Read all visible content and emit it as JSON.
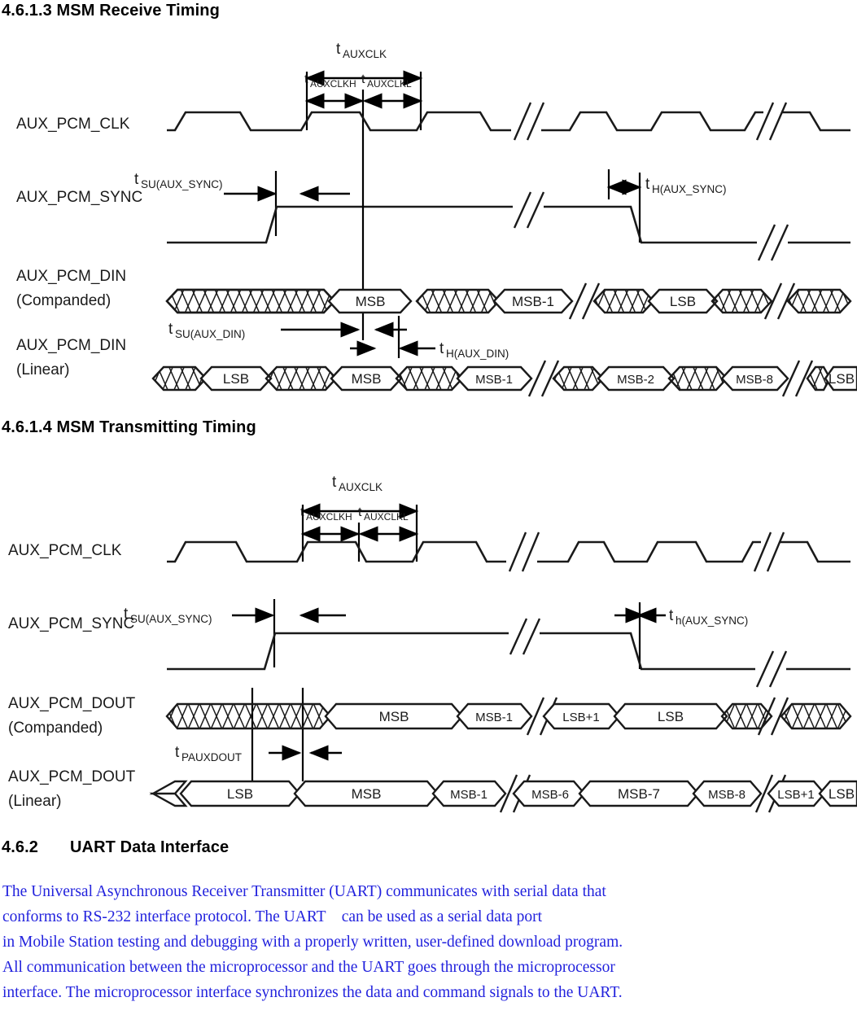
{
  "sections": {
    "receive": {
      "number": "4.6.1.3",
      "title": "MSM Receive Timing",
      "heading": "4.6.1.3 MSM Receive Timing",
      "figure_id": "096-008"
    },
    "transmit": {
      "number": "4.6.1.4",
      "title": "MSM Transmitting Timing",
      "heading": "4.6.1.4 MSM Transmitting Timing"
    },
    "uart": {
      "number": "4.6.2",
      "title": "UART Data Interface"
    }
  },
  "figure_receive": {
    "signals": [
      {
        "name": "AUX_PCM_CLK",
        "sub": ""
      },
      {
        "name": "AUX_PCM_SYNC",
        "sub": ""
      },
      {
        "name": "AUX_PCM_DIN",
        "sub": "(Companded)"
      },
      {
        "name": "AUX_PCM_DIN",
        "sub": "(Linear)"
      }
    ],
    "clock_timings": [
      {
        "base": "t",
        "sub": "AUXCLK"
      },
      {
        "base": "t",
        "sub": "AUXCLKH"
      },
      {
        "base": "t",
        "sub": "AUXCLKL"
      }
    ],
    "annotations": [
      {
        "base": "t",
        "sub": "SU(AUX_SYNC)"
      },
      {
        "base": "t",
        "sub": "H(AUX_SYNC)"
      },
      {
        "base": "t",
        "sub": "SU(AUX_DIN)"
      },
      {
        "base": "t",
        "sub": "H(AUX_DIN)"
      }
    ],
    "din_companded_cells": [
      {
        "type": "hatch",
        "label": ""
      },
      {
        "type": "data",
        "label": "MSB"
      },
      {
        "type": "hatch",
        "label": ""
      },
      {
        "type": "data",
        "label": "MSB-1"
      },
      {
        "type": "break",
        "label": ""
      },
      {
        "type": "hatch",
        "label": ""
      },
      {
        "type": "data",
        "label": "LSB"
      },
      {
        "type": "hatch",
        "label": ""
      },
      {
        "type": "break",
        "label": ""
      },
      {
        "type": "hatch",
        "label": ""
      }
    ],
    "din_linear_cells": [
      {
        "type": "hatch",
        "label": ""
      },
      {
        "type": "data",
        "label": "LSB"
      },
      {
        "type": "hatch",
        "label": ""
      },
      {
        "type": "data",
        "label": "MSB"
      },
      {
        "type": "hatch",
        "label": ""
      },
      {
        "type": "data",
        "label": "MSB-1"
      },
      {
        "type": "break",
        "label": ""
      },
      {
        "type": "hatch",
        "label": ""
      },
      {
        "type": "data",
        "label": "MSB-2"
      },
      {
        "type": "hatch",
        "label": ""
      },
      {
        "type": "data",
        "label": "MSB-8"
      },
      {
        "type": "break",
        "label": ""
      },
      {
        "type": "hatch",
        "label": ""
      },
      {
        "type": "data",
        "label": "LSB"
      }
    ],
    "figure_id": "096-008"
  },
  "figure_transmit": {
    "signals": [
      {
        "name": "AUX_PCM_CLK",
        "sub": ""
      },
      {
        "name": "AUX_PCM_SYNC",
        "sub": ""
      },
      {
        "name": "AUX_PCM_DOUT",
        "sub": "(Companded)"
      },
      {
        "name": "AUX_PCM_DOUT",
        "sub": "(Linear)"
      }
    ],
    "clock_timings": [
      {
        "base": "t",
        "sub": "AUXCLK"
      },
      {
        "base": "t",
        "sub": "AUXCLKH"
      },
      {
        "base": "t",
        "sub": "AUXCLKL"
      }
    ],
    "annotations": [
      {
        "base": "t",
        "sub": "SU(AUX_SYNC)"
      },
      {
        "base": "t",
        "sub": "h(AUX_SYNC)"
      },
      {
        "base": "t",
        "sub": "PAUXDOUT"
      }
    ],
    "dout_companded_cells": [
      {
        "type": "hatch",
        "label": ""
      },
      {
        "type": "data",
        "label": "MSB"
      },
      {
        "type": "data",
        "label": "MSB-1"
      },
      {
        "type": "break",
        "label": ""
      },
      {
        "type": "data",
        "label": "LSB+1"
      },
      {
        "type": "data",
        "label": "LSB"
      },
      {
        "type": "hatch",
        "label": ""
      },
      {
        "type": "break",
        "label": ""
      },
      {
        "type": "hatch",
        "label": ""
      }
    ],
    "dout_linear_cells": [
      {
        "type": "data",
        "label": "LSB"
      },
      {
        "type": "data",
        "label": "MSB"
      },
      {
        "type": "data",
        "label": "MSB-1"
      },
      {
        "type": "break",
        "label": ""
      },
      {
        "type": "data",
        "label": "MSB-6"
      },
      {
        "type": "data",
        "label": "MSB-7"
      },
      {
        "type": "data",
        "label": "MSB-8"
      },
      {
        "type": "break",
        "label": ""
      },
      {
        "type": "data",
        "label": "LSB+1"
      },
      {
        "type": "data",
        "label": "LSB"
      }
    ]
  },
  "uart_body": {
    "line1": "The Universal Asynchronous Receiver Transmitter (UART) communicates with serial data that",
    "line2": "conforms to RS-232 interface protocol. The UART    can be used as a serial data port",
    "line3": "in Mobile Station testing and debugging with a properly written, user-defined download program.",
    "line4": "All communication between the microprocessor and the UART goes through the microprocessor",
    "line5": "interface. The microprocessor interface synchronizes the data and command signals to the UART."
  },
  "colors": {
    "body_text": "#2222dd",
    "ink": "#1a1a1a",
    "background": "#ffffff"
  }
}
